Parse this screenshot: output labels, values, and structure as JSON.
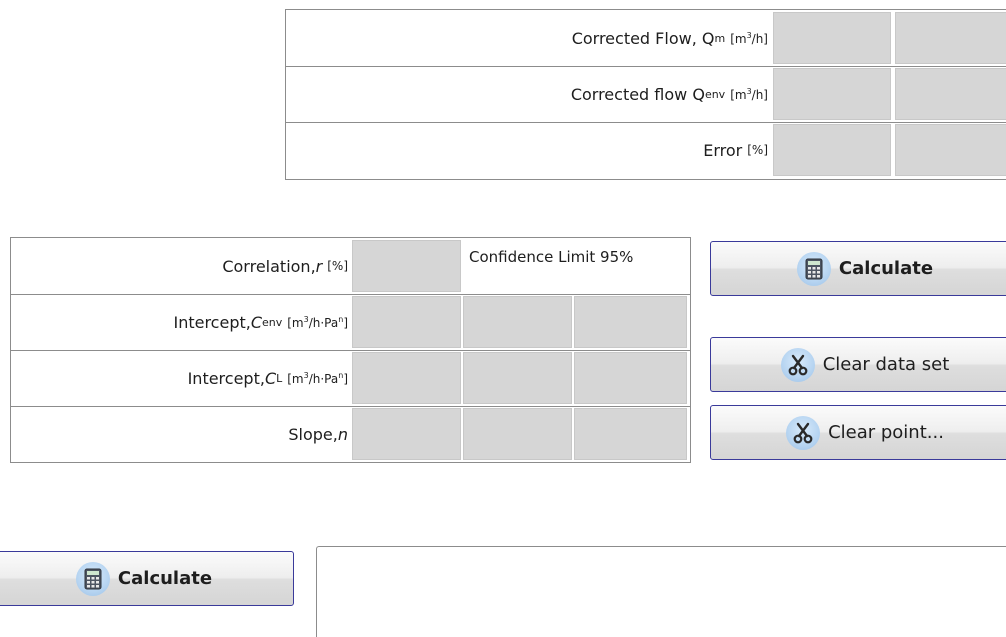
{
  "top_table": {
    "rows": [
      {
        "label": "Corrected Flow, Q",
        "sub": "m",
        "unit_pre": "[m",
        "unit_sup": "3",
        "unit_post": "/h]"
      },
      {
        "label": "Corrected flow Q",
        "sub": "env",
        "unit_pre": "[m",
        "unit_sup": "3",
        "unit_post": "/h]"
      },
      {
        "label": "Error",
        "unit": "[%]"
      }
    ]
  },
  "mid_table": {
    "confidence_label": "Confidence Limit 95%",
    "rows": [
      {
        "label": "Correlation, ",
        "var": "r",
        "unit": "[%]"
      },
      {
        "label": "Intercept, ",
        "var": "C",
        "sub": "env",
        "unit_pre": "[m",
        "unit_sup": "3",
        "unit_mid": "/h·Pa",
        "unit_sup2": "n",
        "unit_post": "]"
      },
      {
        "label": "Intercept, ",
        "var": "C",
        "sub": "L",
        "unit_pre": "[m",
        "unit_sup": "3",
        "unit_mid": "/h·Pa",
        "unit_sup2": "n",
        "unit_post": "]"
      },
      {
        "label": "Slope, ",
        "var": "n"
      }
    ]
  },
  "buttons": {
    "calculate": "Calculate",
    "clear_data_set": "Clear data set",
    "clear_point": "Clear point...",
    "calculate_bottom": "Calculate"
  },
  "colors": {
    "cell_fill": "#d6d6d6",
    "button_border": "#3a3a9a",
    "icon_blue": "#9cc1e6"
  }
}
